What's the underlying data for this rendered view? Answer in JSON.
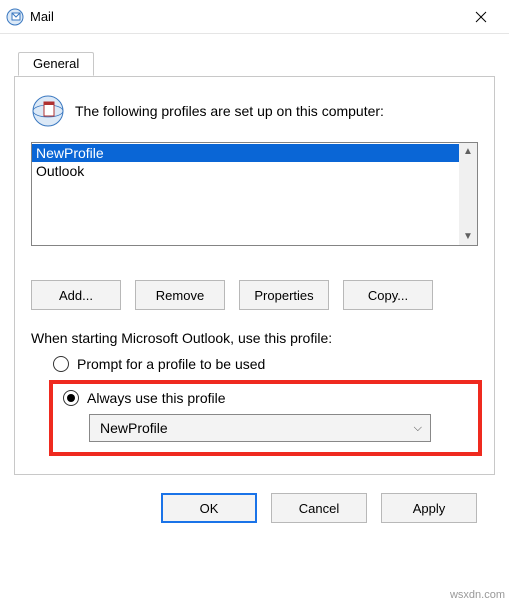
{
  "window": {
    "title": "Mail"
  },
  "tab": {
    "label": "General"
  },
  "profiles": {
    "header_text": "The following profiles are set up on this computer:",
    "items": [
      {
        "label": "NewProfile",
        "selected": true
      },
      {
        "label": "Outlook",
        "selected": false
      }
    ]
  },
  "buttons": {
    "add": "Add...",
    "remove": "Remove",
    "properties": "Properties",
    "copy": "Copy..."
  },
  "startup": {
    "label": "When starting Microsoft Outlook, use this profile:",
    "option_prompt": "Prompt for a profile to be used",
    "option_always": "Always use this profile",
    "selected_profile": "NewProfile"
  },
  "dialog": {
    "ok": "OK",
    "cancel": "Cancel",
    "apply": "Apply"
  },
  "watermark": "wsxdn.com"
}
